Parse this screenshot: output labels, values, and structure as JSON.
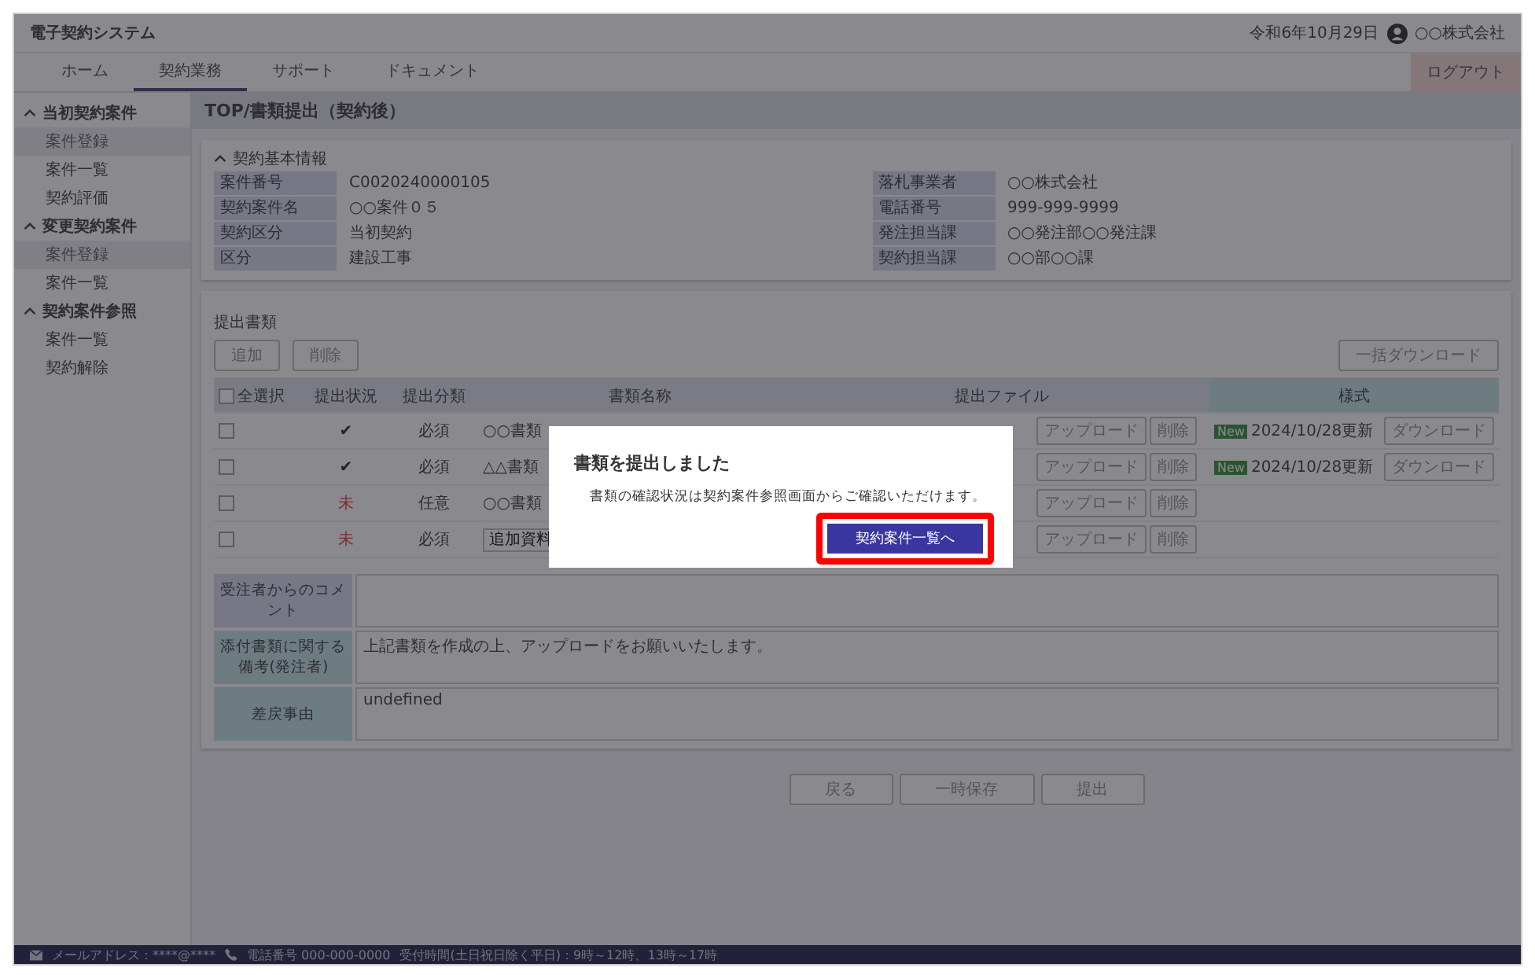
{
  "header": {
    "title": "電子契約システム",
    "date": "令和6年10月29日",
    "user": "○○株式会社"
  },
  "tabs": [
    {
      "label": "ホーム",
      "selected": false
    },
    {
      "label": "契約業務",
      "selected": true
    },
    {
      "label": "サポート",
      "selected": false
    },
    {
      "label": "ドキュメント",
      "selected": false
    }
  ],
  "logout": "ログアウト",
  "sidebar": {
    "groups": [
      {
        "label": "当初契約案件",
        "expanded": true,
        "items": [
          {
            "label": "案件登録",
            "selected": true
          },
          {
            "label": "案件一覧",
            "selected": false
          },
          {
            "label": "契約評価",
            "selected": false
          }
        ]
      },
      {
        "label": "変更契約案件",
        "expanded": true,
        "items": [
          {
            "label": "案件登録",
            "selected": true
          },
          {
            "label": "案件一覧",
            "selected": false
          }
        ]
      },
      {
        "label": "契約案件参照",
        "expanded": true,
        "items": [
          {
            "label": "案件一覧",
            "selected": false
          },
          {
            "label": "契約解除",
            "selected": false
          }
        ]
      }
    ]
  },
  "page_title": "TOP/書類提出（契約後）",
  "basic_info": {
    "title": "契約基本情報",
    "expanded": true,
    "left": [
      {
        "label": "案件番号",
        "value": "C0020240000105"
      },
      {
        "label": "契約案件名",
        "value": "○○案件０５"
      },
      {
        "label": "契約区分",
        "value": "当初契約"
      },
      {
        "label": "区分",
        "value": "建設工事"
      }
    ],
    "right": [
      {
        "label": "落札事業者",
        "value": "○○株式会社"
      },
      {
        "label": "電話番号",
        "value": "999-999-9999"
      },
      {
        "label": "発注担当課",
        "value": "○○発注部○○発注課"
      },
      {
        "label": "契約担当課",
        "value": "○○部○○課"
      }
    ]
  },
  "documents": {
    "title": "提出書類",
    "add_button": "追加",
    "delete_button": "削除",
    "download_all_button": "一括ダウンロード",
    "columns": [
      "全選択",
      "提出状況",
      "提出分類",
      "書類名称",
      "提出ファイル",
      "様式"
    ],
    "select_all_checked": false,
    "rows": [
      {
        "checked": false,
        "kind": "submitted",
        "status_mark": "✔",
        "category": "必須",
        "name": "○○書類",
        "upload": "アップロード",
        "delete": "削除",
        "badge": "New",
        "template": "2024/10/28更新",
        "download": "ダウンロード"
      },
      {
        "checked": false,
        "kind": "submitted",
        "status_mark": "✔",
        "category": "必須",
        "name": "△△書類",
        "upload": "アップロード",
        "delete": "削除",
        "badge": "New",
        "template": "2024/10/28更新",
        "download": "ダウンロード"
      },
      {
        "checked": false,
        "kind": "missing",
        "status_mark": "未",
        "category": "任意",
        "name": "○○書類",
        "upload": "アップロード",
        "delete": "削除"
      },
      {
        "checked": false,
        "kind": "missing",
        "status_mark": "未",
        "category": "必須",
        "name_input": "追加資料",
        "upload": "アップロード",
        "delete": "削除"
      }
    ]
  },
  "remarks": [
    {
      "label": "受注者からのコメント",
      "kind": "contractor"
    },
    {
      "label": "添付書類に関する備考(発注者)",
      "value": "上記書類を作成の上、アップロードをお願いいたします。",
      "kind": "orderer"
    },
    {
      "label": "差戻事由",
      "value": "undefined",
      "kind": "orderer"
    }
  ],
  "actions": [
    "戻る",
    "一時保存",
    "提出"
  ],
  "footer": {
    "mail": "メールアドレス：****@****",
    "phone": "電話番号 000-000-0000",
    "hours": "受付時間(土日祝日除く平日)：9時～12時、13時～17時"
  },
  "dialog": {
    "title": "書類を提出しました",
    "message": "書類の確認状況は契約案件参照画面からご確認いただけます。",
    "button": "契約案件一覧へ",
    "button_highlighted": true
  }
}
